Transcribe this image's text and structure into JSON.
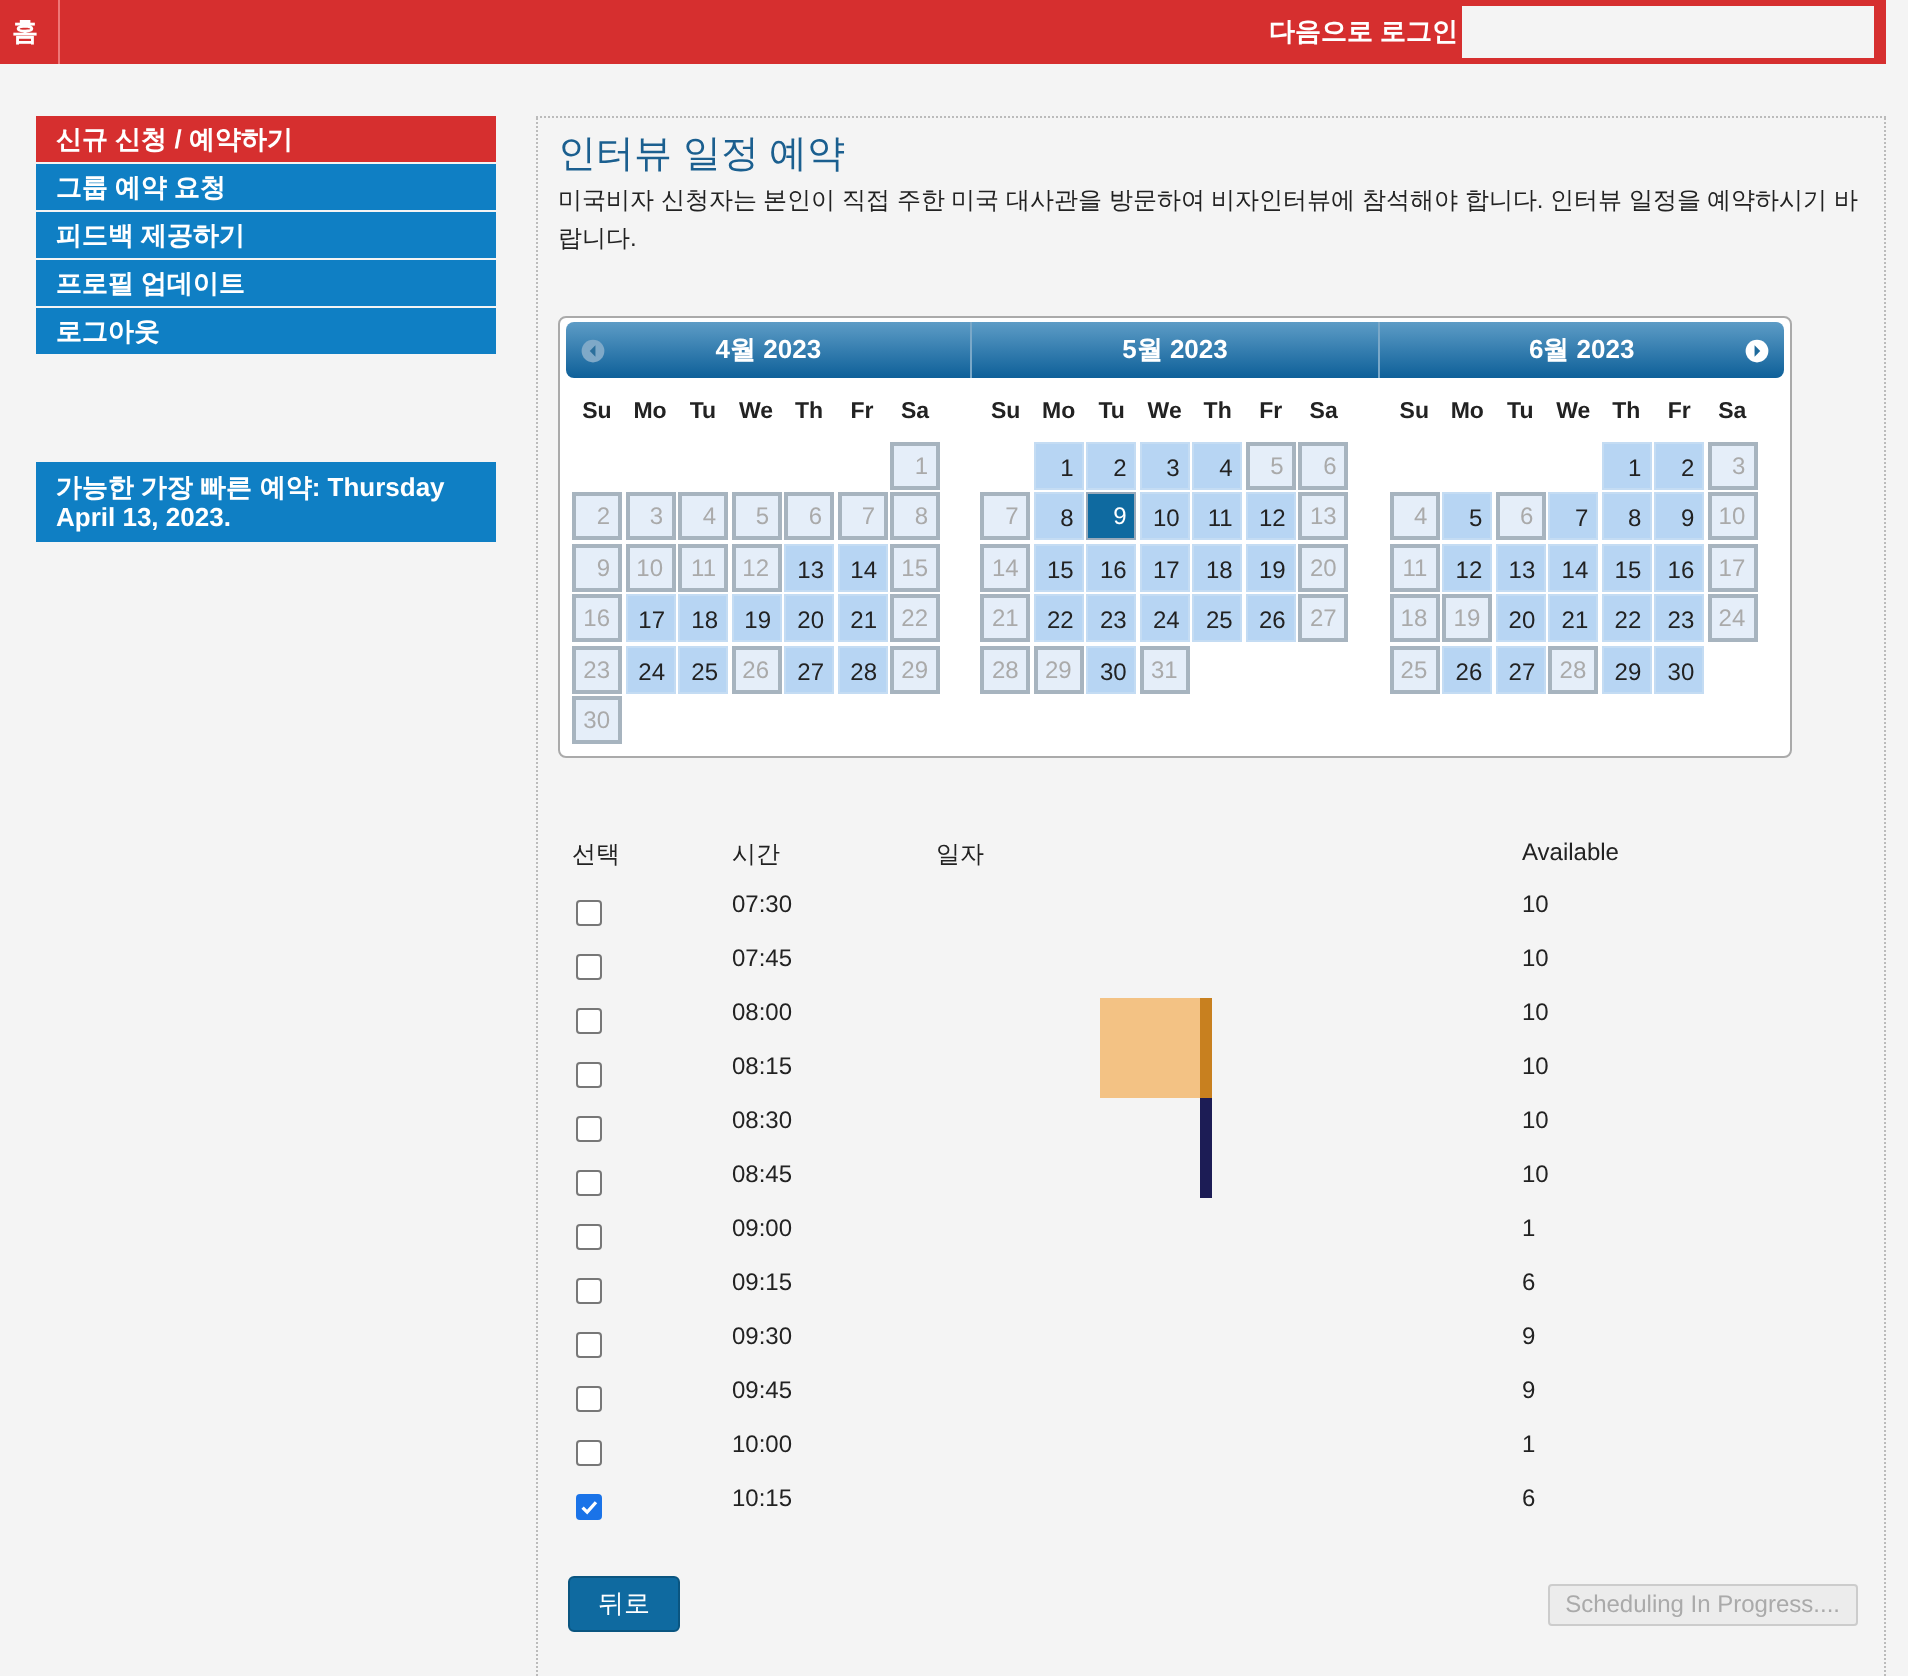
{
  "topbar": {
    "home": "홈",
    "login_label": "다음으로 로그인"
  },
  "sidebar": {
    "items": [
      {
        "label": "신규 신청 / 예약하기",
        "selected": true
      },
      {
        "label": "그룹 예약 요청",
        "selected": false
      },
      {
        "label": "피드백 제공하기",
        "selected": false
      },
      {
        "label": "프로필 업데이트",
        "selected": false
      },
      {
        "label": "로그아웃",
        "selected": false
      }
    ],
    "notice": "가능한 가장 빠른 예약: Thursday April 13, 2023."
  },
  "main": {
    "title": "인터뷰 일정 예약",
    "description": "미국비자 신청자는 본인이 직접 주한 미국 대사관을 방문하여 비자인터뷰에 참석해야 합니다. 인터뷰 일정을 예약하시기 바랍니다."
  },
  "calendar": {
    "months": [
      {
        "title": "4월 2023",
        "weekdays": [
          "Su",
          "Mo",
          "Tu",
          "We",
          "Th",
          "Fr",
          "Sa"
        ],
        "weeks": [
          [
            {
              "kind": "blank"
            },
            {
              "kind": "blank"
            },
            {
              "kind": "blank"
            },
            {
              "kind": "blank"
            },
            {
              "kind": "blank"
            },
            {
              "kind": "blank"
            },
            {
              "kind": "day",
              "day": "1",
              "available": false,
              "selected": false
            }
          ],
          [
            {
              "kind": "day",
              "day": "2",
              "available": false,
              "selected": false
            },
            {
              "kind": "day",
              "day": "3",
              "available": false,
              "selected": false
            },
            {
              "kind": "day",
              "day": "4",
              "available": false,
              "selected": false
            },
            {
              "kind": "day",
              "day": "5",
              "available": false,
              "selected": false
            },
            {
              "kind": "day",
              "day": "6",
              "available": false,
              "selected": false
            },
            {
              "kind": "day",
              "day": "7",
              "available": false,
              "selected": false
            },
            {
              "kind": "day",
              "day": "8",
              "available": false,
              "selected": false
            }
          ],
          [
            {
              "kind": "day",
              "day": "9",
              "available": false,
              "selected": false
            },
            {
              "kind": "day",
              "day": "10",
              "available": false,
              "selected": false
            },
            {
              "kind": "day",
              "day": "11",
              "available": false,
              "selected": false
            },
            {
              "kind": "day",
              "day": "12",
              "available": false,
              "selected": false
            },
            {
              "kind": "day",
              "day": "13",
              "available": true,
              "selected": false
            },
            {
              "kind": "day",
              "day": "14",
              "available": true,
              "selected": false
            },
            {
              "kind": "day",
              "day": "15",
              "available": false,
              "selected": false
            }
          ],
          [
            {
              "kind": "day",
              "day": "16",
              "available": false,
              "selected": false
            },
            {
              "kind": "day",
              "day": "17",
              "available": true,
              "selected": false
            },
            {
              "kind": "day",
              "day": "18",
              "available": true,
              "selected": false
            },
            {
              "kind": "day",
              "day": "19",
              "available": true,
              "selected": false
            },
            {
              "kind": "day",
              "day": "20",
              "available": true,
              "selected": false
            },
            {
              "kind": "day",
              "day": "21",
              "available": true,
              "selected": false
            },
            {
              "kind": "day",
              "day": "22",
              "available": false,
              "selected": false
            }
          ],
          [
            {
              "kind": "day",
              "day": "23",
              "available": false,
              "selected": false
            },
            {
              "kind": "day",
              "day": "24",
              "available": true,
              "selected": false
            },
            {
              "kind": "day",
              "day": "25",
              "available": true,
              "selected": false
            },
            {
              "kind": "day",
              "day": "26",
              "available": false,
              "selected": false
            },
            {
              "kind": "day",
              "day": "27",
              "available": true,
              "selected": false
            },
            {
              "kind": "day",
              "day": "28",
              "available": true,
              "selected": false
            },
            {
              "kind": "day",
              "day": "29",
              "available": false,
              "selected": false
            }
          ],
          [
            {
              "kind": "day",
              "day": "30",
              "available": false,
              "selected": false
            }
          ]
        ]
      },
      {
        "title": "5월 2023",
        "weekdays": [
          "Su",
          "Mo",
          "Tu",
          "We",
          "Th",
          "Fr",
          "Sa"
        ],
        "weeks": [
          [
            {
              "kind": "blank"
            },
            {
              "kind": "day",
              "day": "1",
              "available": true,
              "selected": false
            },
            {
              "kind": "day",
              "day": "2",
              "available": true,
              "selected": false
            },
            {
              "kind": "day",
              "day": "3",
              "available": true,
              "selected": false
            },
            {
              "kind": "day",
              "day": "4",
              "available": true,
              "selected": false
            },
            {
              "kind": "day",
              "day": "5",
              "available": false,
              "selected": false
            },
            {
              "kind": "day",
              "day": "6",
              "available": false,
              "selected": false
            }
          ],
          [
            {
              "kind": "day",
              "day": "7",
              "available": false,
              "selected": false
            },
            {
              "kind": "day",
              "day": "8",
              "available": true,
              "selected": false
            },
            {
              "kind": "day",
              "day": "9",
              "available": true,
              "selected": true
            },
            {
              "kind": "day",
              "day": "10",
              "available": true,
              "selected": false
            },
            {
              "kind": "day",
              "day": "11",
              "available": true,
              "selected": false
            },
            {
              "kind": "day",
              "day": "12",
              "available": true,
              "selected": false
            },
            {
              "kind": "day",
              "day": "13",
              "available": false,
              "selected": false
            }
          ],
          [
            {
              "kind": "day",
              "day": "14",
              "available": false,
              "selected": false
            },
            {
              "kind": "day",
              "day": "15",
              "available": true,
              "selected": false
            },
            {
              "kind": "day",
              "day": "16",
              "available": true,
              "selected": false
            },
            {
              "kind": "day",
              "day": "17",
              "available": true,
              "selected": false
            },
            {
              "kind": "day",
              "day": "18",
              "available": true,
              "selected": false
            },
            {
              "kind": "day",
              "day": "19",
              "available": true,
              "selected": false
            },
            {
              "kind": "day",
              "day": "20",
              "available": false,
              "selected": false
            }
          ],
          [
            {
              "kind": "day",
              "day": "21",
              "available": false,
              "selected": false
            },
            {
              "kind": "day",
              "day": "22",
              "available": true,
              "selected": false
            },
            {
              "kind": "day",
              "day": "23",
              "available": true,
              "selected": false
            },
            {
              "kind": "day",
              "day": "24",
              "available": true,
              "selected": false
            },
            {
              "kind": "day",
              "day": "25",
              "available": true,
              "selected": false
            },
            {
              "kind": "day",
              "day": "26",
              "available": true,
              "selected": false
            },
            {
              "kind": "day",
              "day": "27",
              "available": false,
              "selected": false
            }
          ],
          [
            {
              "kind": "day",
              "day": "28",
              "available": false,
              "selected": false
            },
            {
              "kind": "day",
              "day": "29",
              "available": false,
              "selected": false
            },
            {
              "kind": "day",
              "day": "30",
              "available": true,
              "selected": false
            },
            {
              "kind": "day",
              "day": "31",
              "available": false,
              "selected": false
            }
          ]
        ]
      },
      {
        "title": "6월 2023",
        "weekdays": [
          "Su",
          "Mo",
          "Tu",
          "We",
          "Th",
          "Fr",
          "Sa"
        ],
        "weeks": [
          [
            {
              "kind": "blank"
            },
            {
              "kind": "blank"
            },
            {
              "kind": "blank"
            },
            {
              "kind": "blank"
            },
            {
              "kind": "day",
              "day": "1",
              "available": true,
              "selected": false
            },
            {
              "kind": "day",
              "day": "2",
              "available": true,
              "selected": false
            },
            {
              "kind": "day",
              "day": "3",
              "available": false,
              "selected": false
            }
          ],
          [
            {
              "kind": "day",
              "day": "4",
              "available": false,
              "selected": false
            },
            {
              "kind": "day",
              "day": "5",
              "available": true,
              "selected": false
            },
            {
              "kind": "day",
              "day": "6",
              "available": false,
              "selected": false
            },
            {
              "kind": "day",
              "day": "7",
              "available": true,
              "selected": false
            },
            {
              "kind": "day",
              "day": "8",
              "available": true,
              "selected": false
            },
            {
              "kind": "day",
              "day": "9",
              "available": true,
              "selected": false
            },
            {
              "kind": "day",
              "day": "10",
              "available": false,
              "selected": false
            }
          ],
          [
            {
              "kind": "day",
              "day": "11",
              "available": false,
              "selected": false
            },
            {
              "kind": "day",
              "day": "12",
              "available": true,
              "selected": false
            },
            {
              "kind": "day",
              "day": "13",
              "available": true,
              "selected": false
            },
            {
              "kind": "day",
              "day": "14",
              "available": true,
              "selected": false
            },
            {
              "kind": "day",
              "day": "15",
              "available": true,
              "selected": false
            },
            {
              "kind": "day",
              "day": "16",
              "available": true,
              "selected": false
            },
            {
              "kind": "day",
              "day": "17",
              "available": false,
              "selected": false
            }
          ],
          [
            {
              "kind": "day",
              "day": "18",
              "available": false,
              "selected": false
            },
            {
              "kind": "day",
              "day": "19",
              "available": false,
              "selected": false
            },
            {
              "kind": "day",
              "day": "20",
              "available": true,
              "selected": false
            },
            {
              "kind": "day",
              "day": "21",
              "available": true,
              "selected": false
            },
            {
              "kind": "day",
              "day": "22",
              "available": true,
              "selected": false
            },
            {
              "kind": "day",
              "day": "23",
              "available": true,
              "selected": false
            },
            {
              "kind": "day",
              "day": "24",
              "available": false,
              "selected": false
            }
          ],
          [
            {
              "kind": "day",
              "day": "25",
              "available": false,
              "selected": false
            },
            {
              "kind": "day",
              "day": "26",
              "available": true,
              "selected": false
            },
            {
              "kind": "day",
              "day": "27",
              "available": true,
              "selected": false
            },
            {
              "kind": "day",
              "day": "28",
              "available": false,
              "selected": false
            },
            {
              "kind": "day",
              "day": "29",
              "available": true,
              "selected": false
            },
            {
              "kind": "day",
              "day": "30",
              "available": true,
              "selected": false
            }
          ]
        ]
      }
    ]
  },
  "slots": {
    "columns": [
      "선택",
      "시간",
      "일자",
      "Available"
    ],
    "rows": [
      {
        "time": "07:30",
        "available": "10",
        "checked": false
      },
      {
        "time": "07:45",
        "available": "10",
        "checked": false
      },
      {
        "time": "08:00",
        "available": "10",
        "checked": false
      },
      {
        "time": "08:15",
        "available": "10",
        "checked": false
      },
      {
        "time": "08:30",
        "available": "10",
        "checked": false
      },
      {
        "time": "08:45",
        "available": "10",
        "checked": false
      },
      {
        "time": "09:00",
        "available": "1",
        "checked": false
      },
      {
        "time": "09:15",
        "available": "6",
        "checked": false
      },
      {
        "time": "09:30",
        "available": "9",
        "checked": false
      },
      {
        "time": "09:45",
        "available": "9",
        "checked": false
      },
      {
        "time": "10:00",
        "available": "1",
        "checked": false
      },
      {
        "time": "10:15",
        "available": "6",
        "checked": true
      }
    ]
  },
  "buttons": {
    "back": "뒤로",
    "submit": {
      "label": "Scheduling In Progress....",
      "disabled": true
    }
  }
}
